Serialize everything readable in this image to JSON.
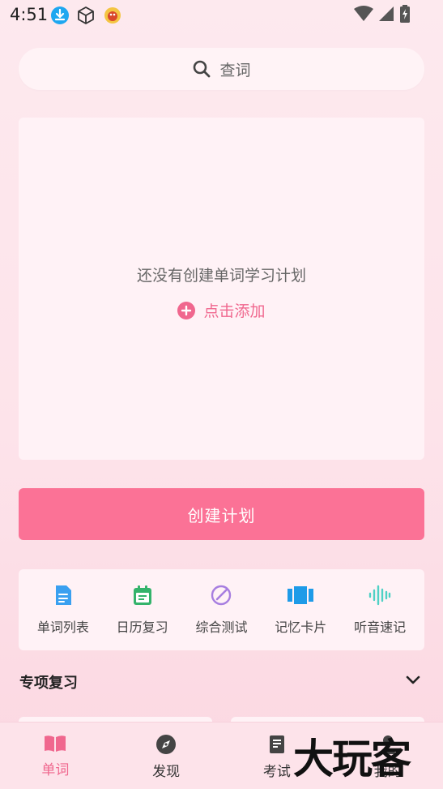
{
  "status_bar": {
    "time": "4:51",
    "left_icons": [
      "download-icon",
      "package-icon",
      "app-mascot-icon"
    ],
    "right_icons": [
      "wifi-icon",
      "signal-icon",
      "battery-icon"
    ]
  },
  "search": {
    "placeholder": "查词"
  },
  "plan_card": {
    "empty_text": "还没有创建单词学习计划",
    "add_label": "点击添加"
  },
  "create_button": {
    "label": "创建计划"
  },
  "tools": [
    {
      "label": "单词列表",
      "icon": "document-icon",
      "color": "#3aa0f0"
    },
    {
      "label": "日历复习",
      "icon": "calendar-icon",
      "color": "#34b36b"
    },
    {
      "label": "综合测试",
      "icon": "test-icon",
      "color": "#a77ee0"
    },
    {
      "label": "记忆卡片",
      "icon": "cards-icon",
      "color": "#1e9be8"
    },
    {
      "label": "听音速记",
      "icon": "audio-wave-icon",
      "color": "#4fd1c5"
    }
  ],
  "section": {
    "title": "专项复习"
  },
  "bottom_nav": [
    {
      "label": "单词",
      "icon": "book-icon",
      "active": true
    },
    {
      "label": "发现",
      "icon": "compass-icon",
      "active": false
    },
    {
      "label": "考试",
      "icon": "exam-icon",
      "active": false
    },
    {
      "label": "我的",
      "icon": "profile-icon",
      "active": false
    }
  ],
  "watermark": {
    "text": "大玩客"
  },
  "colors": {
    "accent": "#fb7296",
    "accent_text": "#f0678e",
    "card_bg": "#fff2f6"
  }
}
